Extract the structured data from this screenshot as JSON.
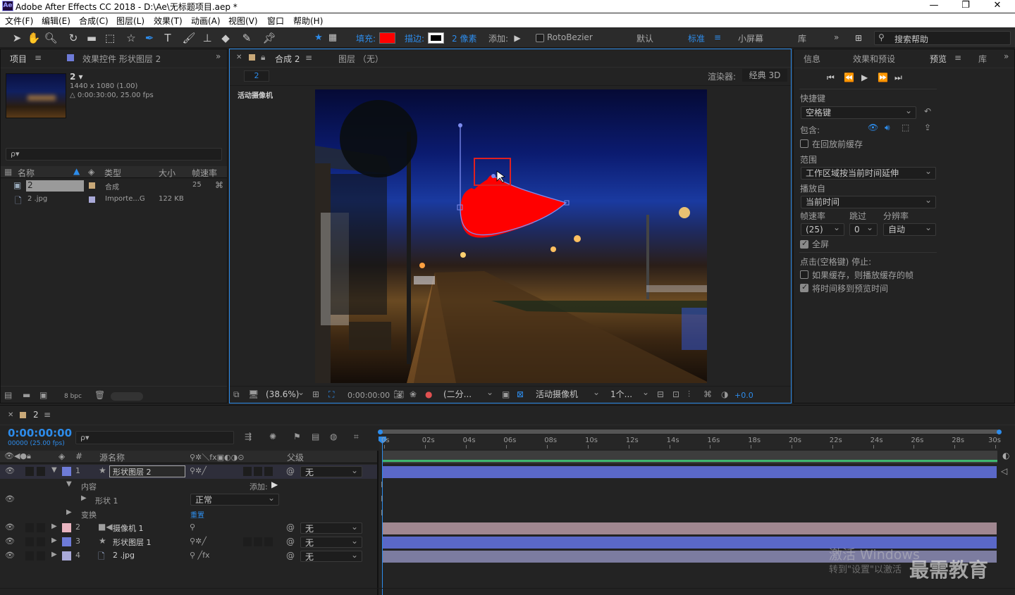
{
  "titlebar": {
    "logo": "Ae",
    "title": "Adobe After Effects CC 2018 - D:\\Ae\\无标题项目.aep *",
    "minimize": "—",
    "maximize": "❐",
    "close": "✕"
  },
  "menu": [
    "文件(F)",
    "编辑(E)",
    "合成(C)",
    "图层(L)",
    "效果(T)",
    "动画(A)",
    "视图(V)",
    "窗口",
    "帮助(H)"
  ],
  "toolbar": {
    "fill_label": "填充:",
    "fill_color": "#ff0000",
    "stroke_label": "描边:",
    "stroke_size": "2 像素",
    "add_label": "添加:",
    "rotobezier": "RotoBezier",
    "workspaces": [
      "默认",
      "标准",
      "小屏幕",
      "库"
    ],
    "search_placeholder": "搜索帮助"
  },
  "project": {
    "tab": "项目",
    "effects_tab": "效果控件 形状图层 2",
    "comp_name": "2 ▾",
    "comp_dims": "1440 x 1080 (1.00)",
    "comp_duration": "△ 0:00:30:00, 25.00 fps",
    "search_placeholder": "ρ▾",
    "columns": [
      "名称",
      "类型",
      "大小",
      "帧速率"
    ],
    "rows": [
      {
        "name": "2",
        "type": "合成",
        "size": "",
        "fps": "25"
      },
      {
        "name": "2 .jpg",
        "type": "Importe...G",
        "size": "122 KB",
        "fps": ""
      }
    ],
    "bpc": "8 bpc"
  },
  "composition": {
    "tab": "合成 2",
    "layer_tab": "图层 （无）",
    "breadcrumb": "2",
    "renderer_label": "渲染器:",
    "renderer": "经典 3D",
    "camera_label": "活动摄像机",
    "zoom": "(38.6%)",
    "timecode": "0:00:00:00",
    "resolution": "(二分...",
    "camera_sel": "活动摄像机",
    "view_sel": "1个...",
    "exposure": "+0.0"
  },
  "preview": {
    "tabs": [
      "信息",
      "效果和预设",
      "预览",
      "库"
    ],
    "shortcut_label": "快捷键",
    "shortcut": "空格键",
    "include_label": "包含:",
    "cache_label": "在回放前缓存",
    "range_label": "范围",
    "range": "工作区域按当前时间延伸",
    "play_from_label": "播放自",
    "play_from": "当前时间",
    "fps_label": "帧速率",
    "skip_label": "跳过",
    "res_label": "分辨率",
    "fps": "(25)",
    "skip": "0",
    "res": "自动",
    "fullscreen": "全屏",
    "stop_label": "点击(空格键) 停止:",
    "opt1": "如果缓存，则播放缓存的帧",
    "opt2": "将时间移到预览时间"
  },
  "timeline": {
    "tab": "2",
    "timecode": "0:00:00:00",
    "fps": "00000 (25.00 fps)",
    "search_placeholder": "ρ▾",
    "col_source": "源名称",
    "col_parent": "父级",
    "ticks": [
      "0s",
      "02s",
      "04s",
      "06s",
      "08s",
      "10s",
      "12s",
      "14s",
      "16s",
      "18s",
      "20s",
      "22s",
      "24s",
      "26s",
      "28s",
      "30s"
    ],
    "layers": [
      {
        "num": "1",
        "name": "形状图层 2",
        "parent": "无",
        "color": "#6e7bd8"
      },
      {
        "num": "2",
        "name": "摄像机 1",
        "parent": "无",
        "color": "#e8b4c0"
      },
      {
        "num": "3",
        "name": "形状图层 1",
        "parent": "无",
        "color": "#6e7bd8"
      },
      {
        "num": "4",
        "name": "2 .jpg",
        "parent": "无",
        "color": "#a9a9d8"
      }
    ],
    "content_label": "内容",
    "add_label": "添加:",
    "shape_label": "形状 1",
    "blend": "正常",
    "transform_label": "变换",
    "reset": "重置"
  },
  "watermark": {
    "line1": "激活 Windows",
    "line2": "转到\"设置\"以激活",
    "brand": "最需教育"
  }
}
